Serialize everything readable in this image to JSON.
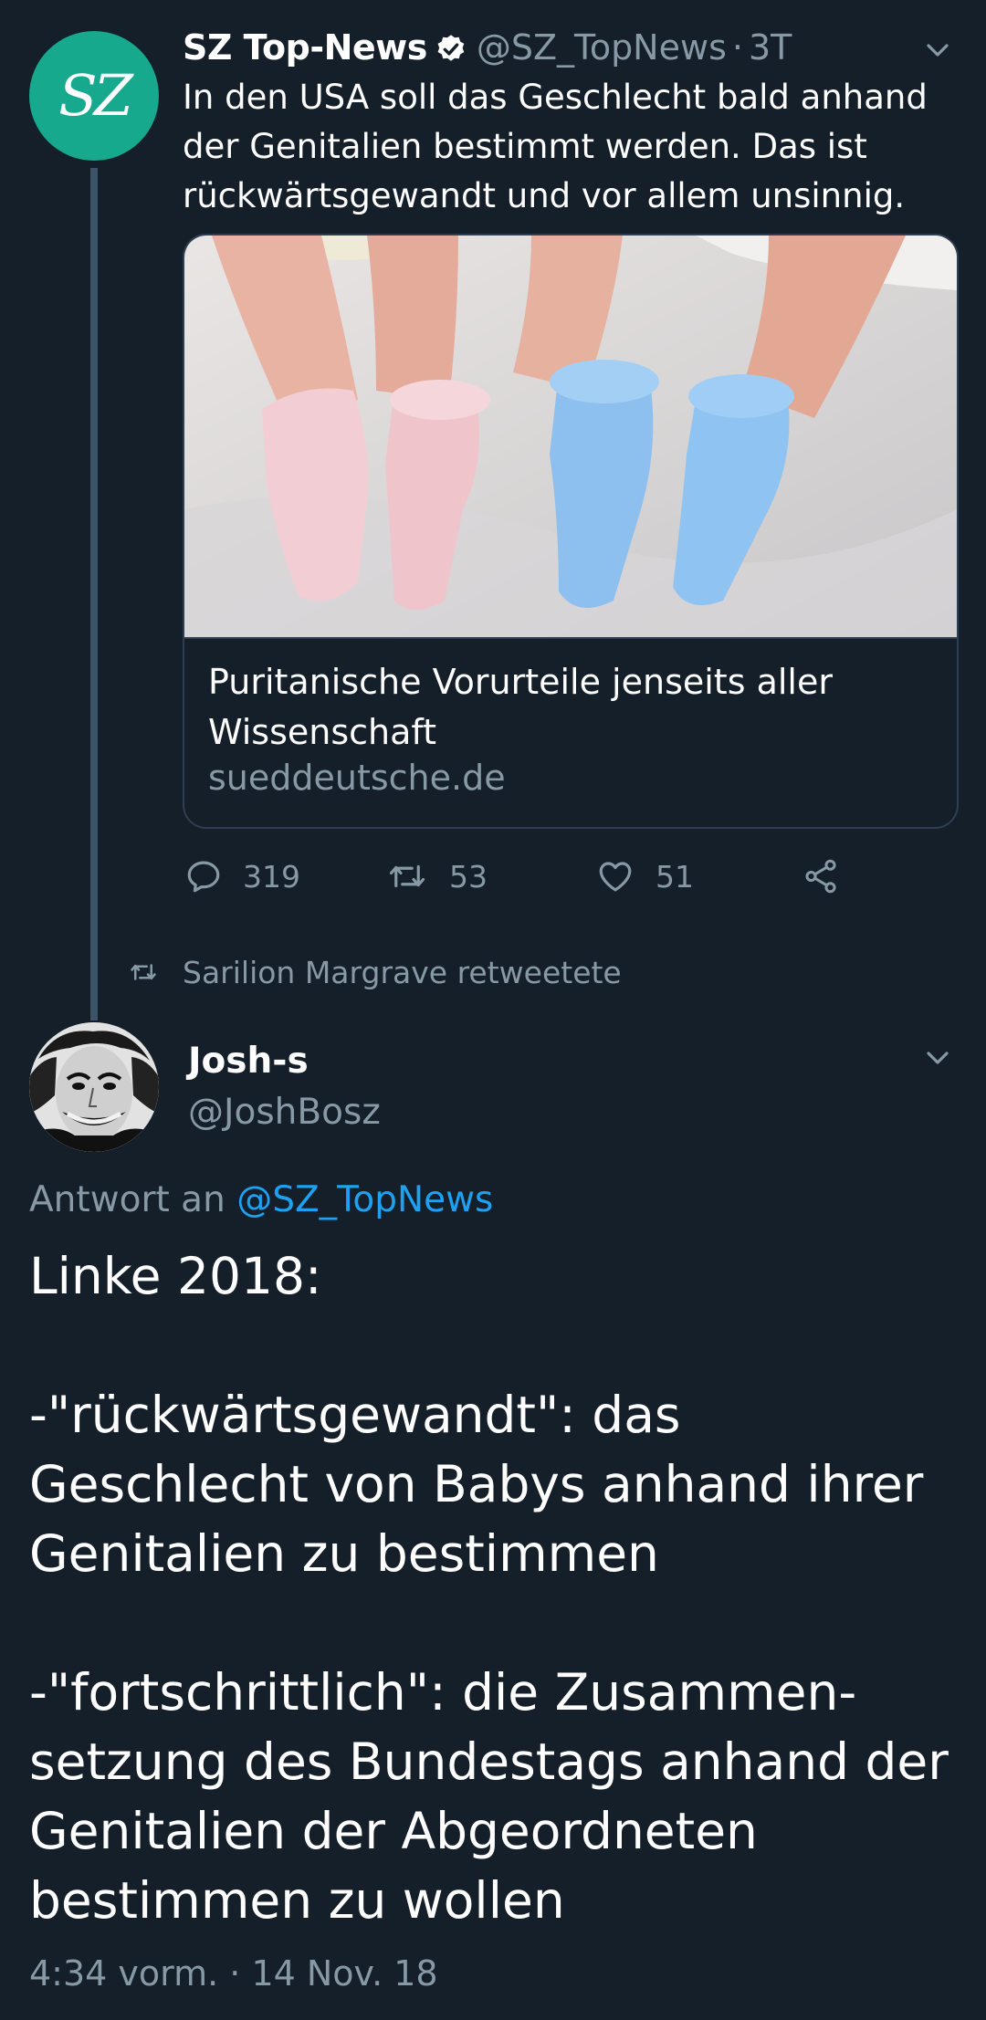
{
  "quoted_tweet": {
    "name": "SZ Top-News",
    "handle": "@SZ_TopNews",
    "separator": "·",
    "time": "3T",
    "avatar_text": "SZ",
    "text": "In den USA soll das Geschlecht bald anhand der Genitalien bestimmt werden. Das ist rückwärtsgewandt und vor allem unsinnig.",
    "card": {
      "title": "Puritanische Vorurteile jenseits aller Wissenschaft",
      "domain": "sueddeutsche.de"
    },
    "actions": {
      "replies": "319",
      "retweets": "53",
      "likes": "51"
    }
  },
  "retweet_context": {
    "text": "Sarilion Margrave retweetete"
  },
  "main_tweet": {
    "name": "Josh-s",
    "handle": "@JoshBosz",
    "reply_prefix": "Antwort an ",
    "reply_mention": "@SZ_TopNews",
    "lines": [
      "Linke 2018:",
      "-\"rückwärtsgewandt\": das Geschlecht von Babys anhand ihrer Genitalien zu bestimmen",
      "-\"fortschrittlich\": die Zusammen-setzung des Bundestags anhand der Genitalien der Abgeordneten bestimmen zu wollen"
    ],
    "timestamp": "4:34 vorm. · 14 Nov. 18"
  },
  "colors": {
    "background": "#151f2a",
    "secondary_text": "#8899a6",
    "link": "#1da1f2",
    "sz_brand": "#16a98d"
  },
  "icons": [
    "verified-badge-icon",
    "chevron-down-icon",
    "reply-icon",
    "retweet-icon",
    "like-icon",
    "share-icon"
  ]
}
